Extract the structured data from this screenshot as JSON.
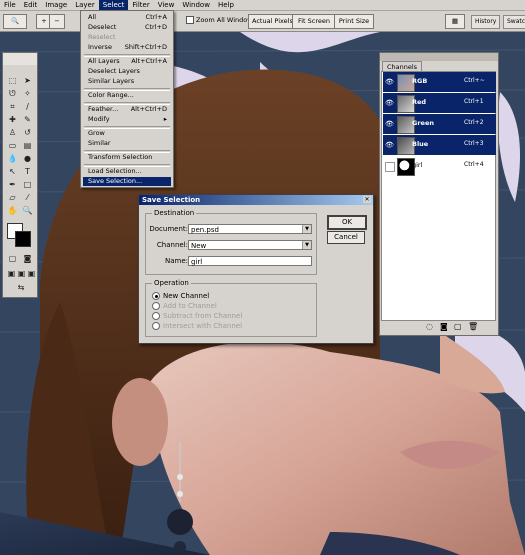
{
  "menubar": {
    "items": [
      "File",
      "Edit",
      "Image",
      "Layer",
      "Select",
      "Filter",
      "View",
      "Window",
      "Help"
    ],
    "active": "Select"
  },
  "options_bar": {
    "tool_icon": "zoom-icon",
    "zoom_all_windows": "Zoom All Windows",
    "actual_pixels": "Actual Pixels",
    "fit_screen": "Fit Screen",
    "print_size": "Print Size",
    "palette_tabs": [
      "History",
      "Swatches"
    ]
  },
  "select_menu": {
    "items": [
      {
        "label": "All",
        "shortcut": "Ctrl+A"
      },
      {
        "label": "Deselect",
        "shortcut": "Ctrl+D"
      },
      {
        "label": "Reselect",
        "shortcut": "",
        "disabled": true
      },
      {
        "label": "Inverse",
        "shortcut": "Shift+Ctrl+D"
      },
      {
        "label": "All Layers",
        "shortcut": "Alt+Ctrl+A"
      },
      {
        "label": "Deselect Layers",
        "shortcut": ""
      },
      {
        "label": "Similar Layers",
        "shortcut": ""
      },
      {
        "label": "Color Range...",
        "shortcut": ""
      },
      {
        "label": "Feather...",
        "shortcut": "Alt+Ctrl+D"
      },
      {
        "label": "Modify",
        "shortcut": "▸"
      },
      {
        "label": "Grow",
        "shortcut": ""
      },
      {
        "label": "Similar",
        "shortcut": ""
      },
      {
        "label": "Transform Selection",
        "shortcut": ""
      },
      {
        "label": "Load Selection...",
        "shortcut": ""
      },
      {
        "label": "Save Selection...",
        "shortcut": "",
        "highlighted": true
      }
    ]
  },
  "channels": {
    "title": "Channels",
    "rows": [
      {
        "name": "RGB",
        "shortcut": "Ctrl+~",
        "selected": true
      },
      {
        "name": "Red",
        "shortcut": "Ctrl+1",
        "selected": true
      },
      {
        "name": "Green",
        "shortcut": "Ctrl+2",
        "selected": true
      },
      {
        "name": "Blue",
        "shortcut": "Ctrl+3",
        "selected": true
      },
      {
        "name": "girl",
        "shortcut": "Ctrl+4",
        "selected": false
      }
    ]
  },
  "dialog": {
    "title": "Save Selection",
    "destination_legend": "Destination",
    "document_label": "Document:",
    "document_value": "pen.psd",
    "channel_label": "Channel:",
    "channel_value": "New",
    "name_label": "Name:",
    "name_value": "girl",
    "operation_legend": "Operation",
    "operations": [
      {
        "label": "New Channel",
        "checked": true,
        "disabled": false
      },
      {
        "label": "Add to Channel",
        "checked": false,
        "disabled": true
      },
      {
        "label": "Subtract from Channel",
        "checked": false,
        "disabled": true
      },
      {
        "label": "Intersect with Channel",
        "checked": false,
        "disabled": true
      }
    ],
    "ok_label": "OK",
    "cancel_label": "Cancel"
  },
  "colors": {
    "menu_highlight": "#0a246a",
    "chrome": "#d6d3ce",
    "lilac_background": "#ddd6ea",
    "photo_blue": "#34465f"
  }
}
